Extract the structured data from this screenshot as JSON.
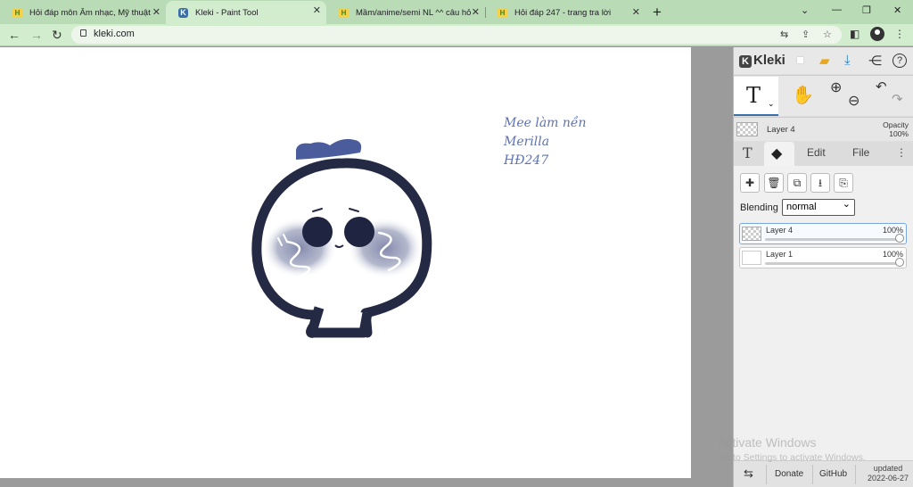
{
  "browser": {
    "tabs": [
      {
        "title": "Hỏi đáp môn Âm nhạc, Mỹ thuật",
        "favicon": "hoidap-icon",
        "active": false
      },
      {
        "title": "Kleki - Paint Tool",
        "favicon": "kleki-icon",
        "active": true
      },
      {
        "title": "Mầm/anime/semi NL ^^ câu hỏi",
        "favicon": "hoidap-icon",
        "active": false
      },
      {
        "title": "Hỏi đáp 247 - trang tra lời",
        "favicon": "hoidap-icon",
        "active": false
      }
    ],
    "url": "kleki.com"
  },
  "canvas": {
    "text_lines": [
      "Mee làm nền",
      "Merilla",
      "HĐ247"
    ]
  },
  "panel": {
    "brand": "Kleki",
    "layer_info": {
      "name": "Layer 4",
      "opacity_label": "Opacity",
      "opacity_value": "100%"
    },
    "tabs": {
      "edit": "Edit",
      "file": "File"
    },
    "blending": {
      "label": "Blending",
      "value": "normal"
    },
    "layers": [
      {
        "name": "Layer 4",
        "opacity": "100%",
        "selected": true
      },
      {
        "name": "Layer 1",
        "opacity": "100%",
        "selected": false
      }
    ],
    "footer": {
      "donate": "Donate",
      "github": "GitHub",
      "updated_label": "updated",
      "updated_date": "2022-06-27"
    }
  },
  "os_watermark": {
    "line1": "Activate Windows",
    "line2": "Go to Settings to activate Windows."
  },
  "colors": {
    "tab_strip": "#b9dcb6",
    "toolbar": "#d2ecce",
    "handwriting": "#5f72b2",
    "character_outline": "#252a44"
  }
}
